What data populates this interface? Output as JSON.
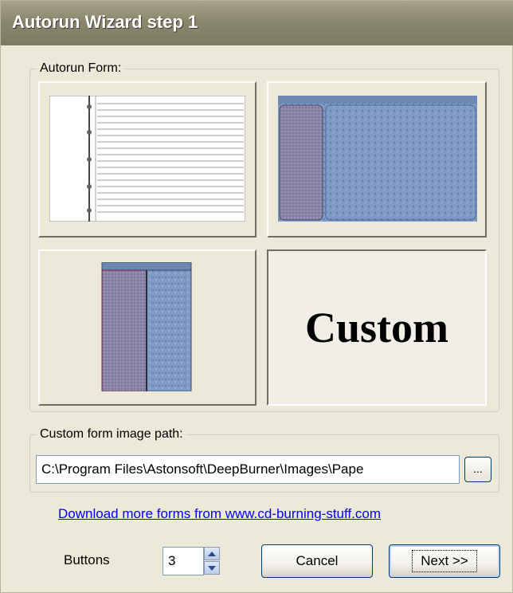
{
  "window": {
    "title": "Autorun Wizard step 1"
  },
  "form_group": {
    "legend": "Autorun Form:",
    "tiles": [
      {
        "name": "notebook-form",
        "selected": false
      },
      {
        "name": "blue-panel-form",
        "selected": false
      },
      {
        "name": "narrow-panel-form",
        "selected": false
      },
      {
        "name": "custom-form",
        "label": "Custom",
        "selected": true
      }
    ]
  },
  "path_group": {
    "legend": "Custom form image path:",
    "value": "C:\\Program Files\\Astonsoft\\DeepBurner\\Images\\Pape",
    "browse_label": "..."
  },
  "download_link": "Download more forms from www.cd-burning-stuff.com",
  "buttons_count": {
    "label": "Buttons",
    "value": "3"
  },
  "actions": {
    "cancel": "Cancel",
    "next": "Next >>"
  },
  "icons": {
    "spin_up": "arrow-up-icon",
    "spin_down": "arrow-down-icon"
  }
}
